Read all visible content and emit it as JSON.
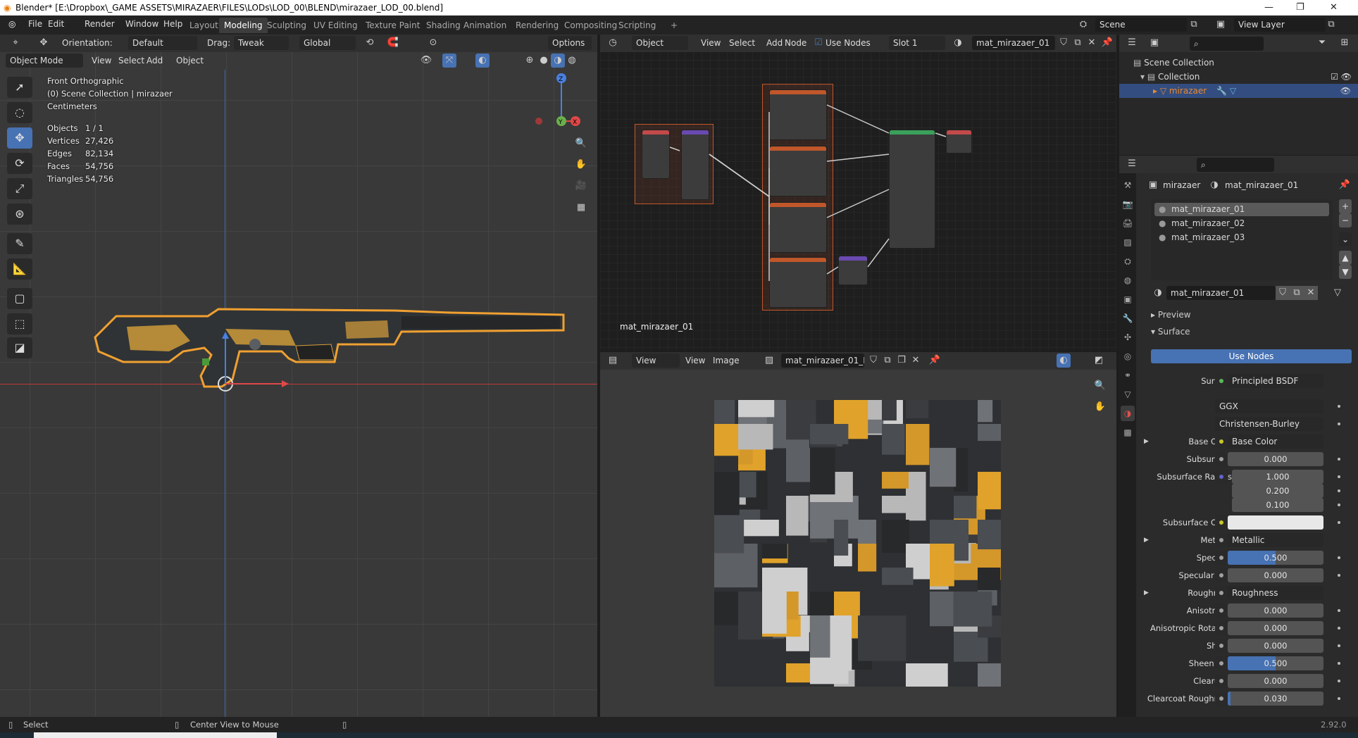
{
  "title": "Blender* [E:\\Dropbox\\_GAME ASSETS\\MIRAZAER\\FILES\\LODs\\LOD_00\\BLEND\\mirazaer_LOD_00.blend]",
  "window_controls": [
    "—",
    "❐",
    "✕"
  ],
  "menu": [
    "File",
    "Edit",
    "Render",
    "Window",
    "Help"
  ],
  "workspaces": [
    "Layout",
    "Modeling",
    "Sculpting",
    "UV Editing",
    "Texture Paint",
    "Shading",
    "Animation",
    "Rendering",
    "Compositing",
    "Scripting",
    "+"
  ],
  "active_workspace": "Modeling",
  "scene": {
    "label": "Scene",
    "view_layer": "View Layer"
  },
  "viewport": {
    "orientation_label": "Orientation:",
    "orientation": "Default",
    "drag_label": "Drag:",
    "drag": "Tweak",
    "transform": "Global",
    "options": "Options",
    "mode": "Object Mode",
    "menus": [
      "View",
      "Select",
      "Add",
      "Object"
    ],
    "overlay": {
      "view": "Front Orthographic",
      "collection": "(0) Scene Collection | mirazaer",
      "units": "Centimeters"
    },
    "stats": [
      [
        "Objects",
        "1 / 1"
      ],
      [
        "Vertices",
        "27,426"
      ],
      [
        "Edges",
        "82,134"
      ],
      [
        "Faces",
        "54,756"
      ],
      [
        "Triangles",
        "54,756"
      ]
    ],
    "gizmo": {
      "z": "Z",
      "y": "Y",
      "x": "X"
    }
  },
  "node_editor": {
    "type": "Object",
    "menus": [
      "View",
      "Select",
      "Add",
      "Node"
    ],
    "use_nodes": "Use Nodes",
    "slot": "Slot 1",
    "material": "mat_mirazaer_01",
    "label": "mat_mirazaer_01"
  },
  "image_editor": {
    "mode": "View",
    "menus": [
      "View",
      "Image"
    ],
    "image": "mat_mirazaer_01_B..."
  },
  "outliner": {
    "items": [
      {
        "label": "Scene Collection"
      },
      {
        "label": "Collection"
      },
      {
        "label": "mirazaer"
      }
    ]
  },
  "properties": {
    "object": "mirazaer",
    "material": "mat_mirazaer_01",
    "slots": [
      "mat_mirazaer_01",
      "mat_mirazaer_02",
      "mat_mirazaer_03"
    ],
    "material_field": "mat_mirazaer_01",
    "panels": {
      "preview": "Preview",
      "surface": "Surface"
    },
    "use_nodes": "Use Nodes",
    "rows": [
      {
        "label": "Surface",
        "kind": "link",
        "value": "Principled BSDF",
        "sock": "#5cb85c"
      },
      {
        "label": "",
        "kind": "dropdown",
        "value": "GGX"
      },
      {
        "label": "",
        "kind": "dropdown",
        "value": "Christensen-Burley"
      },
      {
        "label": "Base Color",
        "kind": "link",
        "value": "Base Color",
        "sock": "#c7c729",
        "expand": true
      },
      {
        "label": "Subsurface",
        "kind": "num",
        "value": "0.000",
        "fill": 0
      },
      {
        "label": "Subsurface Radius",
        "kind": "vec",
        "values": [
          "1.000",
          "0.200",
          "0.100"
        ],
        "sock": "#6363c7"
      },
      {
        "label": "Subsurface Color",
        "kind": "color",
        "color": "#e8e8e8",
        "sock": "#c7c729"
      },
      {
        "label": "Metallic",
        "kind": "link",
        "value": "Metallic",
        "expand": true
      },
      {
        "label": "Specular",
        "kind": "num",
        "value": "0.500",
        "fill": 0.5
      },
      {
        "label": "Specular Tint",
        "kind": "num",
        "value": "0.000",
        "fill": 0
      },
      {
        "label": "Roughness",
        "kind": "link",
        "value": "Roughness",
        "expand": true
      },
      {
        "label": "Anisotropic",
        "kind": "num",
        "value": "0.000",
        "fill": 0
      },
      {
        "label": "Anisotropic Rotation",
        "kind": "num",
        "value": "0.000",
        "fill": 0
      },
      {
        "label": "Sheen",
        "kind": "num",
        "value": "0.000",
        "fill": 0
      },
      {
        "label": "Sheen Tint",
        "kind": "num",
        "value": "0.500",
        "fill": 0.5
      },
      {
        "label": "Clearcoat",
        "kind": "num",
        "value": "0.000",
        "fill": 0
      },
      {
        "label": "Clearcoat Roughne...",
        "kind": "num",
        "value": "0.030",
        "fill": 0.03
      }
    ]
  },
  "status": {
    "select": "Select",
    "center": "Center View to Mouse",
    "version": "2.92.0"
  },
  "colors": {
    "accent": "#4772b3",
    "selection": "#f0a030",
    "header": "#303030"
  }
}
